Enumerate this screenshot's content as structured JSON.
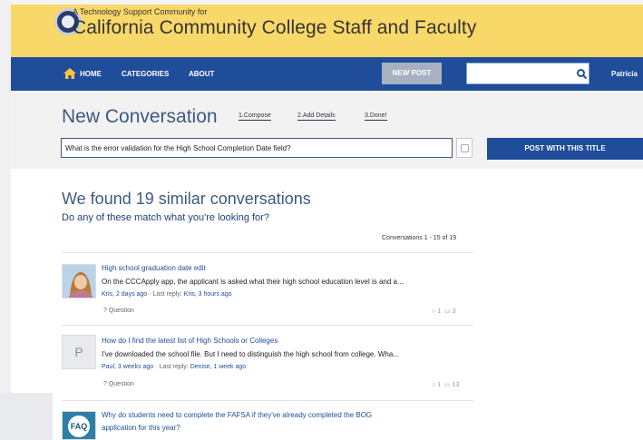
{
  "header": {
    "tagline": "A Technology Support Community for",
    "site_title": "California Community College Staff and Faculty"
  },
  "nav": {
    "home": "HOME",
    "categories": "CATEGORIES",
    "about": "ABOUT",
    "new_post": "NEW POST",
    "search_placeholder": "",
    "user": "Patricia"
  },
  "compose": {
    "heading": "New Conversation",
    "steps": [
      "1.Compose",
      "2.Add Details",
      "3.Done!"
    ],
    "title_value": "What is the error validation for the High School Completion Date field?",
    "post_button": "POST WITH THIS TITLE"
  },
  "results": {
    "heading": "We found 19 similar conversations",
    "subheading": "Do any of these match what you're looking for?",
    "count": "Conversations 1 - 15 of 19",
    "items": [
      {
        "title": "High school graduation date edit",
        "snippet": "On the CCCApply app, the applicant is asked what their high school education level is and a...",
        "author_time": "Kris, 2 days ago",
        "last_reply_label": "Last reply:",
        "last_reply": "Kris, 3 hours ago",
        "type": "Question",
        "votes": "1",
        "replies": "3"
      },
      {
        "avatar_letter": "P",
        "title": "How do I find the latest list of High Schools or Colleges",
        "snippet": "I've downloaded the school file. But I need to distinguish the high school from college. Wha...",
        "author_time": "Paul, 3 weeks ago",
        "last_reply_label": "Last reply:",
        "last_reply": "Denise, 1 week ago",
        "type": "Question",
        "votes": "1",
        "replies": "13"
      },
      {
        "avatar_text": "FAQ",
        "title": "Why do students need to complete the FAFSA if they've already completed the BOG",
        "title_line2": "application for this year?"
      }
    ]
  },
  "colors": {
    "banner": "#f9d86a",
    "nav": "#1f4d9a",
    "accent_text": "#3d5a80"
  }
}
